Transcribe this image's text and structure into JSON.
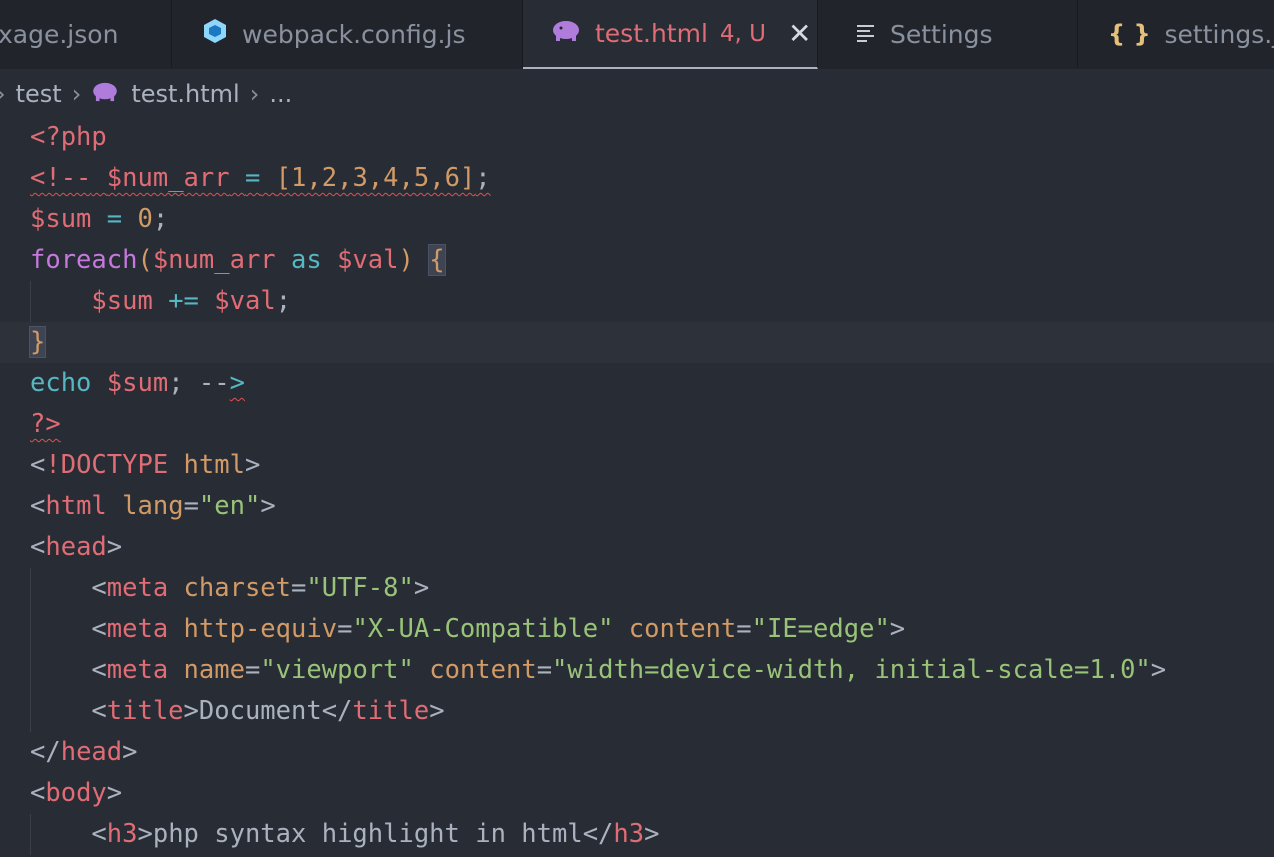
{
  "tabs": [
    {
      "label": "xage.json",
      "icon": "json-file-icon"
    },
    {
      "label": "webpack.config.js",
      "icon": "webpack-icon"
    },
    {
      "label": "test.html",
      "icon": "php-elephant-icon",
      "status": "4, U",
      "active": true
    },
    {
      "label": "Settings",
      "icon": "settings-list-icon"
    },
    {
      "label": "settings.json",
      "icon": "json-braces-icon"
    }
  ],
  "breadcrumb": {
    "folder": "test",
    "file": "test.html",
    "more": "..."
  },
  "code_lines": [
    "<?php",
    "<!-- $num_arr = [1,2,3,4,5,6];",
    "$sum = 0;",
    "foreach($num_arr as $val) {",
    "    $sum += $val;",
    "}",
    "echo $sum; -->",
    "?>",
    "<!DOCTYPE html>",
    "<html lang=\"en\">",
    "<head>",
    "    <meta charset=\"UTF-8\">",
    "    <meta http-equiv=\"X-UA-Compatible\" content=\"IE=edge\">",
    "    <meta name=\"viewport\" content=\"width=device-width, initial-scale=1.0\">",
    "    <title>Document</title>",
    "</head>",
    "<body>",
    "    <h3>php syntax highlight in html</h3>"
  ],
  "colors": {
    "background": "#282c34",
    "tabbar": "#21252b",
    "accent": "#e06c75"
  }
}
